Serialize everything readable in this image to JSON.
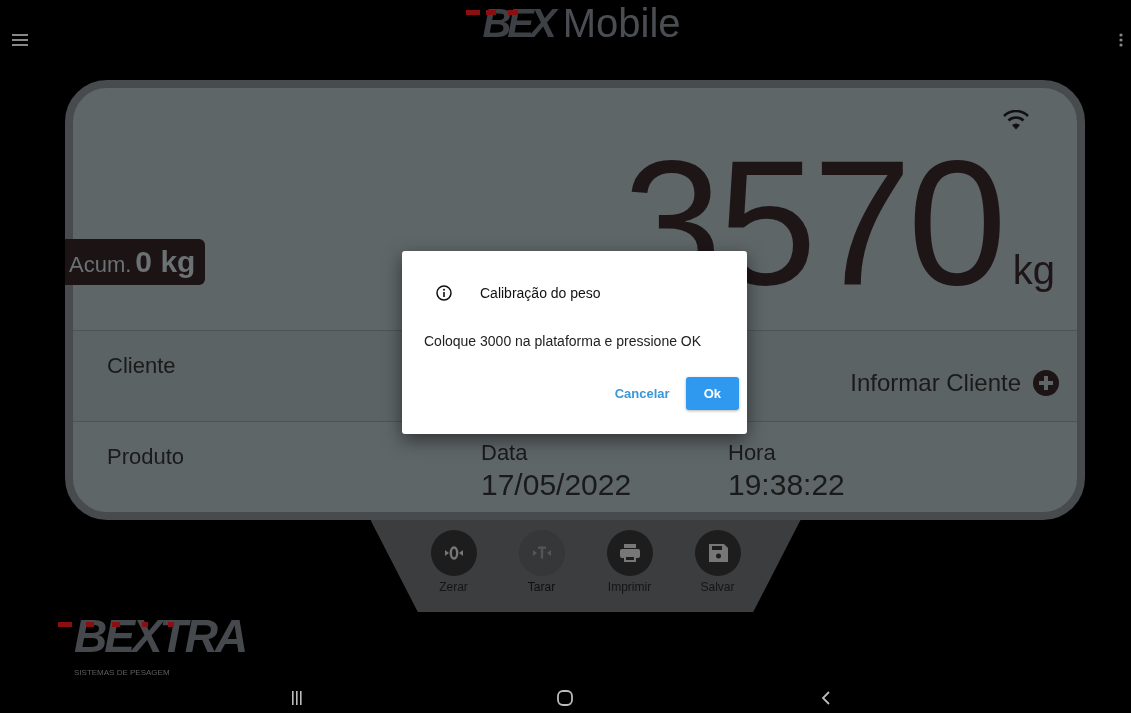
{
  "app_bar": {
    "logo": {
      "mark": "BEX",
      "text": "Mobile"
    }
  },
  "display": {
    "accumulated": {
      "label": "Acum.",
      "value": "0 kg"
    },
    "weight": {
      "value": "3570",
      "unit": "kg"
    }
  },
  "rows": [
    {
      "kind": "client",
      "label": "Cliente",
      "action": "Informar Cliente"
    },
    {
      "kind": "info",
      "label": "Produto",
      "fields": [
        {
          "label": "Data",
          "value": "17/05/2022"
        },
        {
          "label": "Hora",
          "value": "19:38:22"
        }
      ]
    }
  ],
  "actions": [
    {
      "kind": "zero",
      "label": "Zerar",
      "disabled": false
    },
    {
      "kind": "tare",
      "label": "Tarar",
      "disabled": true
    },
    {
      "kind": "print",
      "label": "Imprimir",
      "disabled": false
    },
    {
      "kind": "save",
      "label": "Salvar",
      "disabled": false
    }
  ],
  "brand": {
    "name": "BEXTRA",
    "tagline": "SISTEMAS DE PESAGEM"
  },
  "dialog": {
    "title": "Calibração do peso",
    "message": "Coloque 3000 na plataforma e pressione OK",
    "buttons": [
      {
        "kind": "text",
        "label": "Cancelar"
      },
      {
        "kind": "primary",
        "label": "Ok"
      }
    ]
  }
}
